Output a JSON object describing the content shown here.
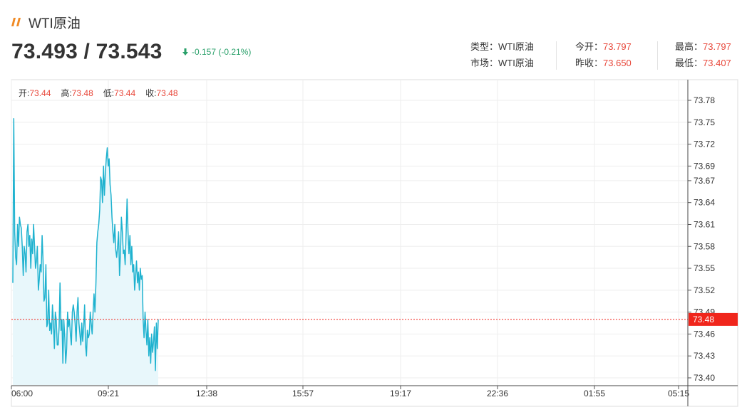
{
  "header": {
    "title": "WTI原油",
    "icon": "slash-logo-icon",
    "accent_color": "#f08a24"
  },
  "quote": {
    "bid_ask": "73.493 / 73.543",
    "change": "-0.157 (-0.21%)",
    "change_color": "#2aa06a"
  },
  "info": {
    "type_label": "类型：",
    "type_value": "WTI原油",
    "market_label": "市场：",
    "market_value": "WTI原油",
    "open_label": "今开：",
    "open_value": "73.797",
    "prev_close_label": "昨收：",
    "prev_close_value": "73.650",
    "high_label": "最高：",
    "high_value": "73.797",
    "low_label": "最低：",
    "low_value": "73.407",
    "value_color": "#e8483b"
  },
  "ohlc": {
    "open_label": "开:",
    "open_value": "73.44",
    "high_label": "高:",
    "high_value": "73.48",
    "low_label": "低:",
    "low_value": "73.44",
    "close_label": "收:",
    "close_value": "73.48"
  },
  "chart_data": {
    "type": "area",
    "line_color": "#1fb2cf",
    "fill_color": "#e8f7fb",
    "current_price": 73.48,
    "current_price_label": "73.48",
    "current_price_color": "#f0261c",
    "ylim": [
      73.385,
      73.805
    ],
    "y_ticks": [
      "73.78",
      "73.75",
      "73.72",
      "73.69",
      "73.67",
      "73.64",
      "73.61",
      "73.58",
      "73.55",
      "73.52",
      "73.49",
      "73.46",
      "73.43",
      "73.40"
    ],
    "y_tick_values": [
      73.78,
      73.75,
      73.72,
      73.69,
      73.67,
      73.64,
      73.61,
      73.58,
      73.55,
      73.52,
      73.49,
      73.46,
      73.43,
      73.4
    ],
    "x_ticks": [
      "06:00",
      "09:21",
      "12:38",
      "15:57",
      "19:17",
      "22:36",
      "01:55",
      "05:15"
    ],
    "grid": true,
    "series": [
      {
        "values": [
          73.53,
          73.755,
          73.6,
          73.565,
          73.555,
          73.61,
          73.58,
          73.62,
          73.61,
          73.605,
          73.58,
          73.54,
          73.58,
          73.57,
          73.545,
          73.6,
          73.61,
          73.58,
          73.595,
          73.55,
          73.59,
          73.57,
          73.61,
          73.58,
          73.55,
          73.56,
          73.58,
          73.52,
          73.535,
          73.555,
          73.545,
          73.595,
          73.56,
          73.505,
          73.51,
          73.555,
          73.47,
          73.475,
          73.52,
          73.465,
          73.475,
          73.46,
          73.5,
          73.475,
          73.44,
          73.49,
          73.48,
          73.445,
          73.445,
          73.47,
          73.53,
          73.465,
          73.48,
          73.42,
          73.48,
          73.455,
          73.42,
          73.44,
          73.49,
          73.47,
          73.48,
          73.46,
          73.445,
          73.49,
          73.5,
          73.49,
          73.475,
          73.45,
          73.49,
          73.51,
          73.475,
          73.46,
          73.445,
          73.475,
          73.45,
          73.47,
          73.5,
          73.445,
          73.43,
          73.465,
          73.455,
          73.46,
          73.49,
          73.475,
          73.46,
          73.49,
          73.515,
          73.49,
          73.53,
          73.585,
          73.6,
          73.61,
          73.63,
          73.675,
          73.67,
          73.64,
          73.69,
          73.65,
          73.68,
          73.7,
          73.715,
          73.69,
          73.7,
          73.665,
          73.65,
          73.62,
          73.6,
          73.585,
          73.61,
          73.575,
          73.565,
          73.58,
          73.6,
          73.54,
          73.57,
          73.62,
          73.6,
          73.57,
          73.575,
          73.555,
          73.6,
          73.645,
          73.6,
          73.57,
          73.595,
          73.555,
          73.58,
          73.545,
          73.555,
          73.52,
          73.54,
          73.56,
          73.53,
          73.545,
          73.52,
          73.55,
          73.535,
          73.54,
          73.48,
          73.455,
          73.49,
          73.465,
          73.445,
          73.48,
          73.43,
          73.455,
          73.42,
          73.46,
          73.435,
          73.45,
          73.47,
          73.41,
          73.475,
          73.44,
          73.48
        ]
      }
    ]
  }
}
